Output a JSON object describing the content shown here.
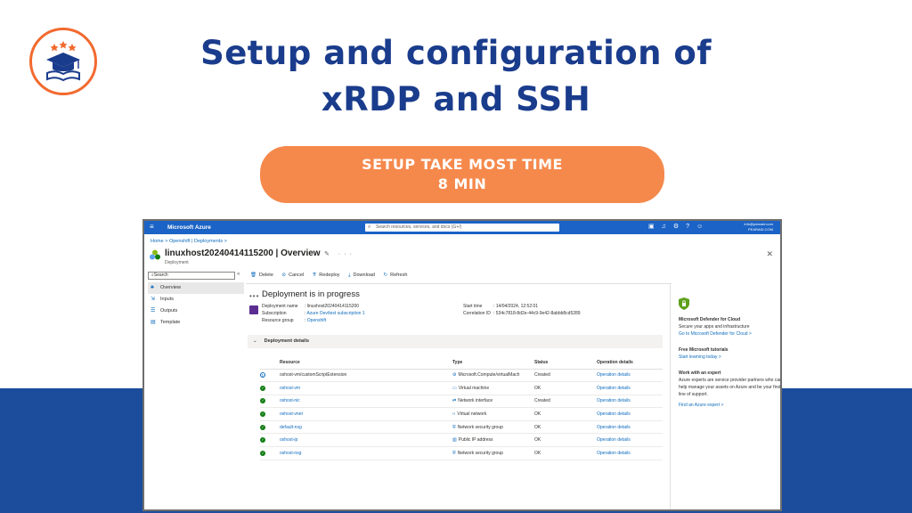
{
  "headline": {
    "line1": "Setup and configuration of",
    "line2": "xRDP and SSH"
  },
  "pill": {
    "line1": "SETUP TAKE MOST TIME",
    "line2": "8 MIN"
  },
  "azure": {
    "brand": "Microsoft Azure",
    "search_placeholder": "Search resources, services, and docs (G+/)",
    "account": {
      "line1": "info@pearaid.com",
      "line2": "PEARAID.COM"
    },
    "breadcrumb": "Home  >  Openshift | Deployments  >",
    "title": "linuxhost20240414115200 | Overview",
    "subtitle": "Deployment",
    "left_search": "Search",
    "nav": [
      {
        "label": "Overview",
        "icon": "overview-icon"
      },
      {
        "label": "Inputs",
        "icon": "inputs-icon"
      },
      {
        "label": "Outputs",
        "icon": "outputs-icon"
      },
      {
        "label": "Template",
        "icon": "template-icon"
      }
    ],
    "toolbar": [
      "Delete",
      "Cancel",
      "Redeploy",
      "Download",
      "Refresh"
    ],
    "status_heading": "Deployment is in progress",
    "details_left": [
      {
        "k": "Deployment name",
        "v": "linuxhost20240414115200"
      },
      {
        "k": "Subscription",
        "v": "Azure Dev/test subscription 1"
      },
      {
        "k": "Resource group",
        "v": "Openshift"
      }
    ],
    "details_right": [
      {
        "k": "Start time",
        "v": "14/04/2024, 12:52:01"
      },
      {
        "k": "Correlation ID",
        "v": "534c7818-8d2e-44c9-9e42-8abbb8cd5289"
      }
    ],
    "section": "Deployment details",
    "columns": [
      "Resource",
      "Type",
      "Status",
      "Operation details"
    ],
    "rows": [
      {
        "resource": "oshost-vm/customScriptExtension",
        "type": "Microsoft.Compute/virtualMach",
        "status": "Created",
        "op": "Operation details",
        "state": "running"
      },
      {
        "resource": "oshost-vm",
        "type": "Virtual machine",
        "status": "OK",
        "op": "Operation details",
        "state": "ok"
      },
      {
        "resource": "oshost-nic",
        "type": "Network interface",
        "status": "Created",
        "op": "Operation details",
        "state": "ok"
      },
      {
        "resource": "oshost-vnet",
        "type": "Virtual network",
        "status": "OK",
        "op": "Operation details",
        "state": "ok"
      },
      {
        "resource": "default-nsg",
        "type": "Network security group",
        "status": "OK",
        "op": "Operation details",
        "state": "ok"
      },
      {
        "resource": "oshost-ip",
        "type": "Public IP address",
        "status": "OK",
        "op": "Operation details",
        "state": "ok"
      },
      {
        "resource": "oshost-nsg",
        "type": "Network security group",
        "status": "OK",
        "op": "Operation details",
        "state": "ok"
      }
    ],
    "right_pane": {
      "defender_title": "Microsoft Defender for Cloud",
      "defender_text": "Secure your apps and infrastructure",
      "defender_link": "Go to Microsoft Defender for Cloud >",
      "tutorials_title": "Free Microsoft tutorials",
      "tutorials_link": "Start learning today >",
      "expert_title": "Work with an expert",
      "expert_text": "Azure experts are service provider partners who can help manage your assets on Azure and be your first line of support.",
      "expert_link": "Find an Azure expert >"
    }
  },
  "colors": {
    "navy": "#1a3c8c",
    "orange": "#f5894c",
    "band": "#1c4d9c",
    "azure_blue": "#1b63c6"
  }
}
